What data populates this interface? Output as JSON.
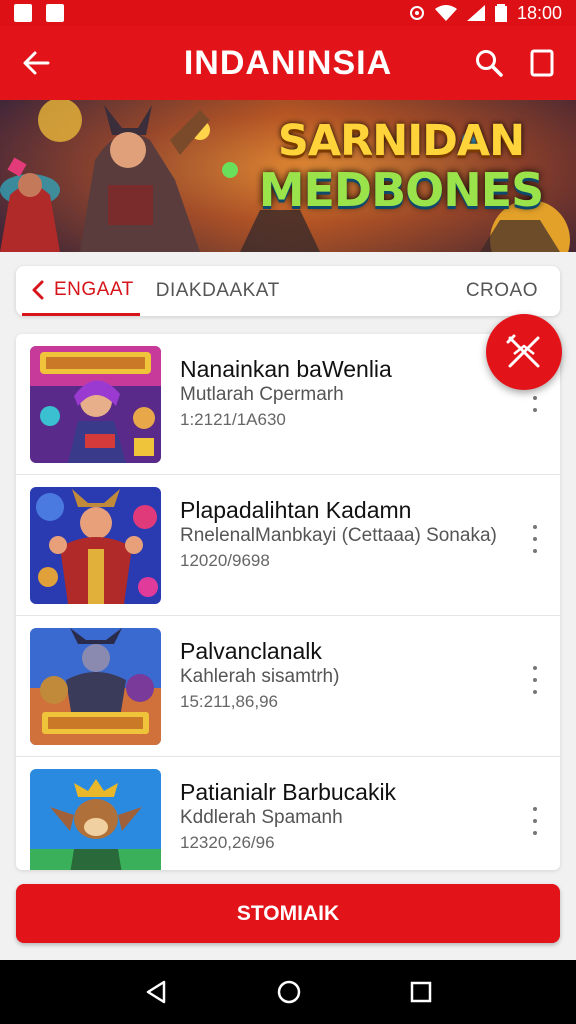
{
  "status_bar": {
    "time": "18:00",
    "icons": [
      "notification-icon",
      "image-icon",
      "alarm-icon",
      "wifi-icon",
      "signal-icon",
      "battery-icon"
    ]
  },
  "app_bar": {
    "title": "INDANINSIA"
  },
  "banner": {
    "title_line1": "SARNIDAN",
    "title_line2": "MEDBONES"
  },
  "tabs": [
    "ENGAAT",
    "DIAKDAAKAT",
    "CROAO"
  ],
  "items": [
    {
      "title": "Nanainkan baWenlia",
      "subtitle": "Mutlarah Cpermarh",
      "number": "1:2121/1A630"
    },
    {
      "title": "Plapadalihtan Kadamn",
      "subtitle": "RnelenalManbkayi (Cettaaa) Sonaka)",
      "number": "12020/9698"
    },
    {
      "title": "Palvanclanalk",
      "subtitle": "Kahlerah sisamtrh)",
      "number": "15:211,86,96"
    },
    {
      "title": "Patianialr Barbucakik",
      "subtitle": "Kddlerah Spamanh",
      "number": "12320,26/96"
    }
  ],
  "cta": {
    "label": "STOMIAIK"
  },
  "colors": {
    "primary": "#e31419",
    "status": "#dd1016",
    "nav": "#000000"
  }
}
